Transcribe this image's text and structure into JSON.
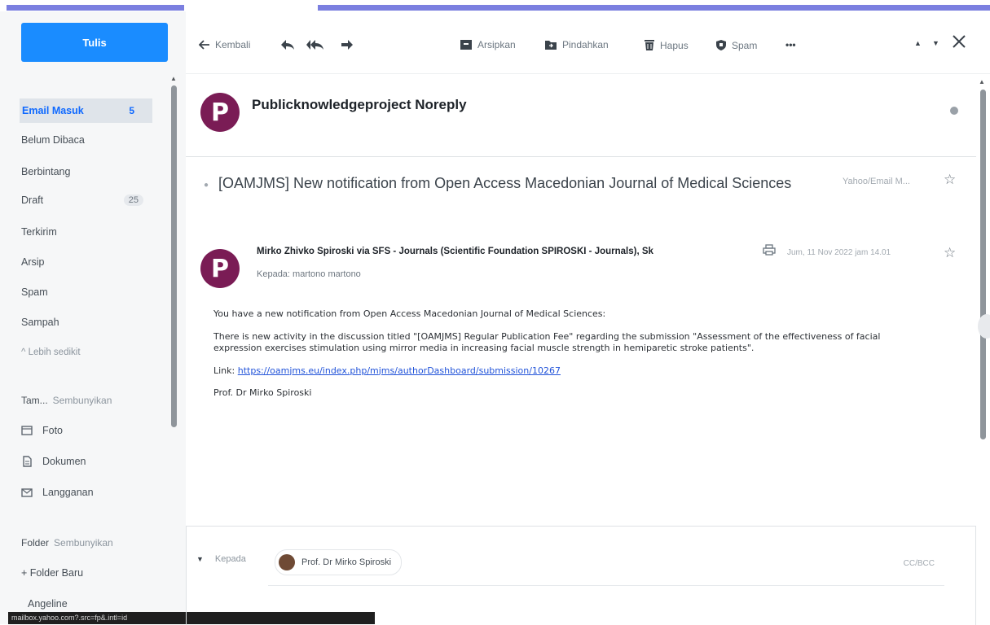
{
  "compose": {
    "label": "Tulis"
  },
  "nav": {
    "items": [
      {
        "label": "Email Masuk",
        "count": "5"
      },
      {
        "label": "Belum Dibaca"
      },
      {
        "label": "Berbintang"
      },
      {
        "label": "Draft",
        "count": "25"
      },
      {
        "label": "Terkirim"
      },
      {
        "label": "Arsip"
      },
      {
        "label": "Spam"
      },
      {
        "label": "Sampah"
      },
      {
        "label": "^ Lebih sedikit"
      }
    ]
  },
  "views": {
    "heading": "Tam...",
    "hide": "Sembunyikan",
    "items": [
      {
        "label": "Foto",
        "icon": "photo-icon"
      },
      {
        "label": "Dokumen",
        "icon": "document-icon"
      },
      {
        "label": "Langganan",
        "icon": "subscription-icon"
      }
    ]
  },
  "folders": {
    "heading": "Folder",
    "hide": "Sembunyikan",
    "new_folder": "+ Folder Baru",
    "items": [
      "Angeline"
    ]
  },
  "status_tooltip": "mailbox.yahoo.com?.src=fp&.intl=id",
  "toolbar": {
    "back": "Kembali",
    "archive": "Arsipkan",
    "move": "Pindahkan",
    "delete": "Hapus",
    "spam": "Spam",
    "more": "•••"
  },
  "message": {
    "sender_initial": "P",
    "sender_name": "Publicknowledgeproject Noreply",
    "subject": "[OAMJMS] New notification from Open Access Macedonian Journal of Medical Sciences",
    "folder_label": "Yahoo/Email M...",
    "from": "Mirko Zhivko Spiroski via SFS - Journals (Scientific Foundation SPIROSKI - Journals), Sk",
    "to": "Kepada: martono martono",
    "date": "Jum, 11 Nov 2022 jam 14.01",
    "body": {
      "p1": "You have a new notification from Open Access Macedonian Journal of Medical Sciences:",
      "p2": "There is new activity in the discussion titled \"[OAMJMS] Regular Publication Fee\" regarding the submission \"Assessment of the effectiveness of facial expression exercises stimulation using mirror media in increasing facial muscle strength in hemiparetic stroke patients\".",
      "link_label": "Link:",
      "link": "https://oamjms.eu/index.php/mjms/authorDashboard/submission/10267",
      "signature": "Prof. Dr Mirko Spiroski"
    }
  },
  "reply": {
    "to_label": "Kepada",
    "recipient": "Prof. Dr Mirko Spiroski",
    "cc_bcc": "CC/BCC"
  },
  "colors": {
    "accent": "#1a8cff",
    "avatar": "#7a1c55",
    "stripe": "#7b7fe0"
  }
}
